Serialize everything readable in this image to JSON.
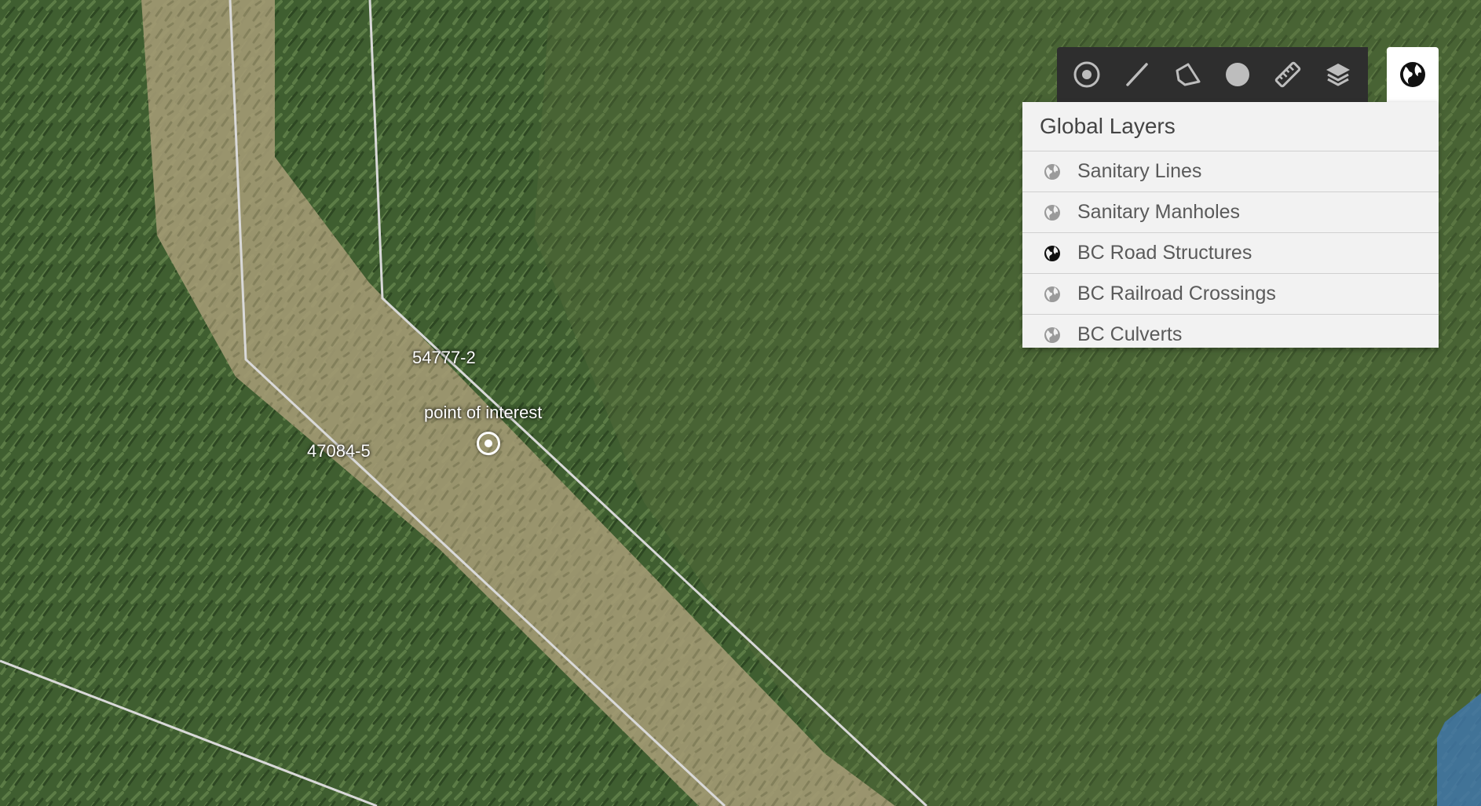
{
  "map": {
    "parcel_labels": [
      "54777-2",
      "47084-5"
    ],
    "poi_label": "point of interest",
    "colors": {
      "vegetation": "#3f5e30",
      "path": "#a39a74",
      "boundary": "#d9d9d9",
      "water": "#3f78b8"
    }
  },
  "toolbar": {
    "tools": [
      {
        "name": "marker-tool",
        "icon": "target-icon"
      },
      {
        "name": "line-tool",
        "icon": "line-icon"
      },
      {
        "name": "polygon-tool",
        "icon": "polygon-icon"
      },
      {
        "name": "circle-tool",
        "icon": "circle-icon"
      },
      {
        "name": "measure-tool",
        "icon": "ruler-icon"
      },
      {
        "name": "layers-tool",
        "icon": "layers-icon"
      }
    ],
    "globe_toggle_icon": "globe-icon",
    "background_color": "#2e2e2e"
  },
  "layers_panel": {
    "title": "Global Layers",
    "layers": [
      {
        "label": "Sanitary Lines",
        "active": false
      },
      {
        "label": "Sanitary Manholes",
        "active": false
      },
      {
        "label": "BC Road Structures",
        "active": true
      },
      {
        "label": "BC Railroad Crossings",
        "active": false
      },
      {
        "label": "BC Culverts",
        "active": false
      }
    ]
  }
}
